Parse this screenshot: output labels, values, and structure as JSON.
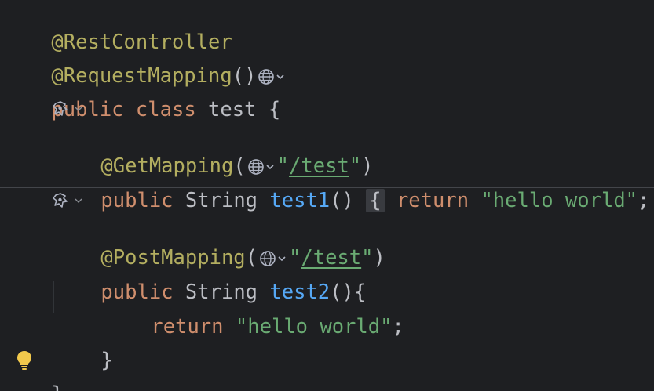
{
  "editor": {
    "lines": {
      "l1": {
        "annotation": "@RestController"
      },
      "l2": {
        "annotation": "@RequestMapping",
        "parens": "()"
      },
      "l3": {
        "kw_public": "public",
        "kw_class": "class",
        "name": "test",
        "brace": "{"
      },
      "l5": {
        "annotation": "@GetMapping",
        "open": "(",
        "q1": "\"",
        "path": "/test",
        "q2": "\"",
        "close": ")"
      },
      "l6": {
        "kw_public": "public",
        "type": "String",
        "method": "test1",
        "parens": "()",
        "lbrace": "{",
        "kw_return": "return",
        "str": "\"hello world\"",
        "semi": ";",
        "rbrace": "}"
      },
      "l8": {
        "annotation": "@PostMapping",
        "open": "(",
        "q1": "\"",
        "path": "/test",
        "q2": "\"",
        "close": ")"
      },
      "l9": {
        "kw_public": "public",
        "type": "String",
        "method": "test2",
        "parens": "(){"
      },
      "l10": {
        "kw_return": "return",
        "str": "\"hello world\"",
        "semi": ";"
      },
      "l11": {
        "brace": "}"
      },
      "l12": {
        "brace": "}"
      }
    },
    "colors": {
      "background": "#1e1f22",
      "annotation": "#b3ae60",
      "keyword": "#cf8e6d",
      "method": "#56a8f5",
      "string": "#6aab73",
      "text": "#bcbec4",
      "bulb": "#f2c94c"
    },
    "icons": [
      "globe-icon",
      "chevron-down-icon",
      "spring-bean-icon",
      "lightbulb-icon"
    ]
  }
}
